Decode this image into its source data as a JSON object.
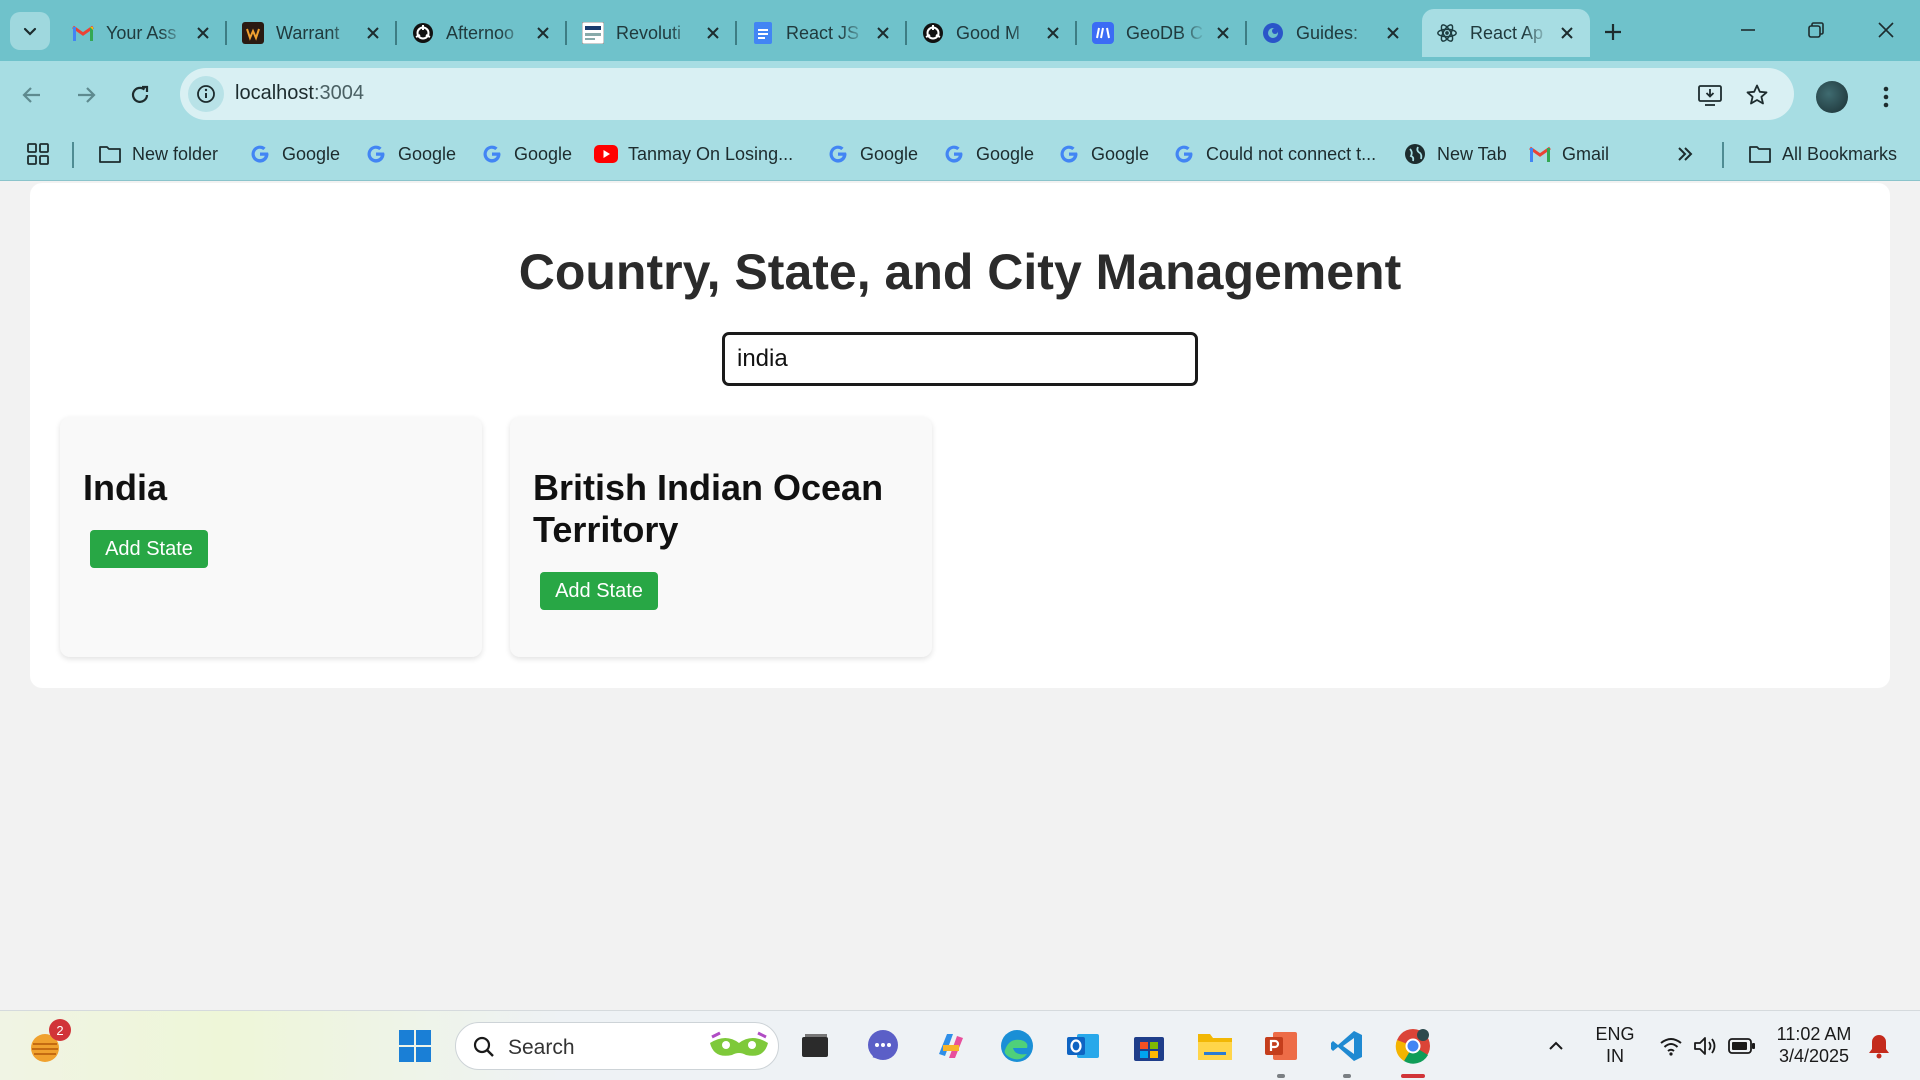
{
  "browser": {
    "tabs": [
      {
        "title": "Your Ass",
        "icon": "gmail-icon"
      },
      {
        "title": "Warrant",
        "icon": "warranty-icon"
      },
      {
        "title": "Afternoo",
        "icon": "openai-icon"
      },
      {
        "title": "Revoluti",
        "icon": "nxt-wave-icon"
      },
      {
        "title": "React JS",
        "icon": "docs-icon"
      },
      {
        "title": "Good M",
        "icon": "openai-icon"
      },
      {
        "title": "GeoDB C",
        "icon": "geodb-icon"
      },
      {
        "title": "Guides:",
        "icon": "guides-icon"
      },
      {
        "title": "React Ap",
        "icon": "react-icon",
        "active": true
      }
    ],
    "url_host": "localhost",
    "url_port": ":3004",
    "bookmarks": [
      {
        "label": "New folder",
        "icon": "folder-icon"
      },
      {
        "label": "Google",
        "icon": "google-icon"
      },
      {
        "label": "Google",
        "icon": "google-icon"
      },
      {
        "label": "Google",
        "icon": "google-icon"
      },
      {
        "label": "Tanmay On Losing...",
        "icon": "youtube-icon"
      },
      {
        "label": "Google",
        "icon": "google-icon"
      },
      {
        "label": "Google",
        "icon": "google-icon"
      },
      {
        "label": "Google",
        "icon": "google-icon"
      },
      {
        "label": "Could not connect t...",
        "icon": "google-icon"
      },
      {
        "label": "New Tab",
        "icon": "globe-icon"
      },
      {
        "label": "Gmail",
        "icon": "gmail-icon"
      }
    ],
    "all_bookmarks": "All Bookmarks"
  },
  "page": {
    "title": "Country, State, and City Management",
    "search_value": "india",
    "countries": [
      {
        "name": "India",
        "button": "Add State"
      },
      {
        "name": "British Indian Ocean Territory",
        "button": "Add State"
      }
    ]
  },
  "taskbar": {
    "search_label": "Search",
    "weather_badge": "2",
    "language_line1": "ENG",
    "language_line2": "IN",
    "time": "11:02 AM",
    "date": "3/4/2025"
  },
  "colors": {
    "tab_bar": "#6fc2cb",
    "toolbar": "#a7dde3",
    "add_button": "#28a745"
  }
}
